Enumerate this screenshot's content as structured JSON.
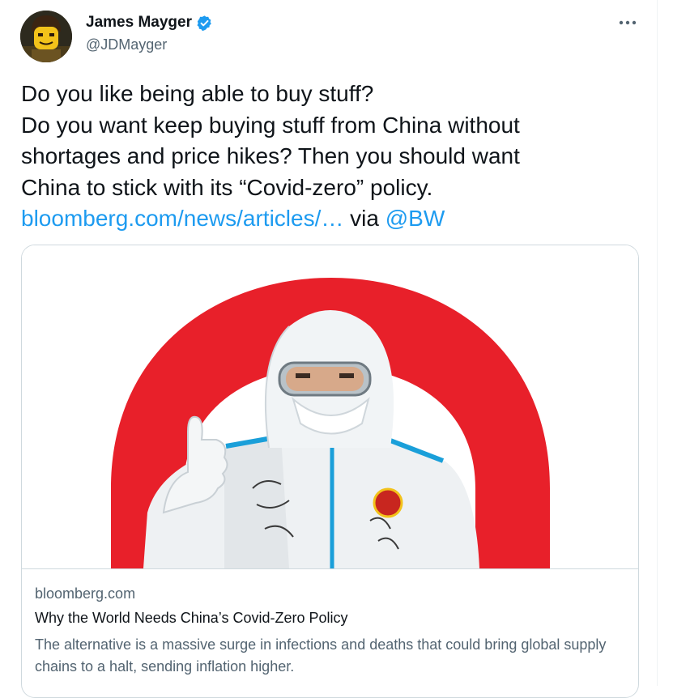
{
  "author": {
    "display_name": "James Mayger",
    "handle": "@JDMayger",
    "verified": true,
    "avatar_icon": "lego-minifigure-avatar"
  },
  "tweet": {
    "lines": [
      "Do you like being able to buy stuff?",
      "Do you want keep buying stuff from China without",
      "shortages and price hikes? Then you should want",
      "China to stick with its “Covid-zero” policy."
    ],
    "link_text": "bloomberg.com/news/articles/…",
    "via_text": " via ",
    "mention": "@BW"
  },
  "card": {
    "domain": "bloomberg.com",
    "title": "Why the World Needs China’s Covid-Zero Policy",
    "description": "The alternative is a massive surge in infections and deaths that could bring global supply chains to a halt, sending inflation higher.",
    "image_icon": "hazmat-worker-thumbs-up-red-zero-illustration"
  },
  "colors": {
    "link": "#1d9bf0",
    "verified_badge": "#1d9bf0",
    "zero_red": "#e8202a",
    "secondary_text": "#536471"
  },
  "icons": {
    "verified": "verified-badge-icon",
    "more": "more-horizontal-icon"
  }
}
